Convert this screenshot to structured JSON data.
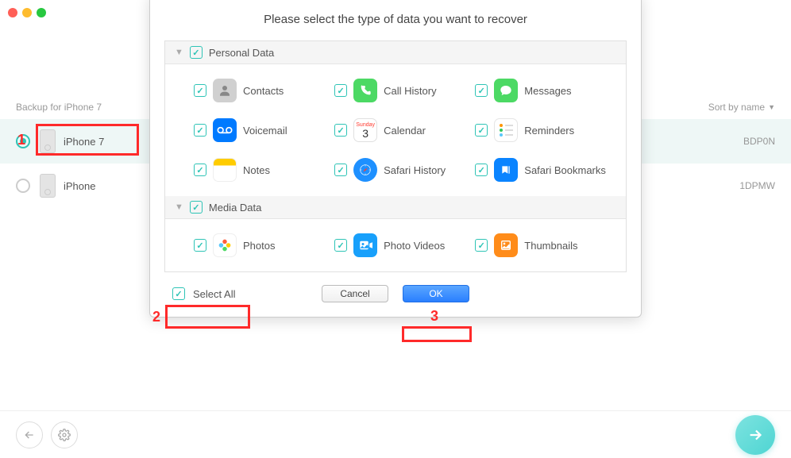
{
  "window": {
    "title": ""
  },
  "background": {
    "header_left": "Backup for iPhone 7",
    "sort_label": "Sort by name",
    "devices": [
      {
        "name": "iPhone 7",
        "id_suffix": "BDP0N",
        "selected": true
      },
      {
        "name": "iPhone",
        "id_suffix": "1DPMW",
        "selected": false
      }
    ]
  },
  "modal": {
    "title": "Please select the type of data you want to recover",
    "select_all_label": "Select All",
    "cancel_label": "Cancel",
    "ok_label": "OK",
    "categories": [
      {
        "name": "Personal Data",
        "items": [
          {
            "label": "Contacts",
            "icon": "contacts"
          },
          {
            "label": "Call History",
            "icon": "call"
          },
          {
            "label": "Messages",
            "icon": "messages"
          },
          {
            "label": "Voicemail",
            "icon": "voicemail"
          },
          {
            "label": "Calendar",
            "icon": "calendar"
          },
          {
            "label": "Reminders",
            "icon": "reminders"
          },
          {
            "label": "Notes",
            "icon": "notes"
          },
          {
            "label": "Safari History",
            "icon": "safari-history"
          },
          {
            "label": "Safari Bookmarks",
            "icon": "safari-bookmarks"
          }
        ]
      },
      {
        "name": "Media Data",
        "items": [
          {
            "label": "Photos",
            "icon": "photos"
          },
          {
            "label": "Photo Videos",
            "icon": "photo-videos"
          },
          {
            "label": "Thumbnails",
            "icon": "thumbnails"
          }
        ]
      }
    ]
  },
  "annotations": {
    "n1": "1",
    "n2": "2",
    "n3": "3"
  }
}
